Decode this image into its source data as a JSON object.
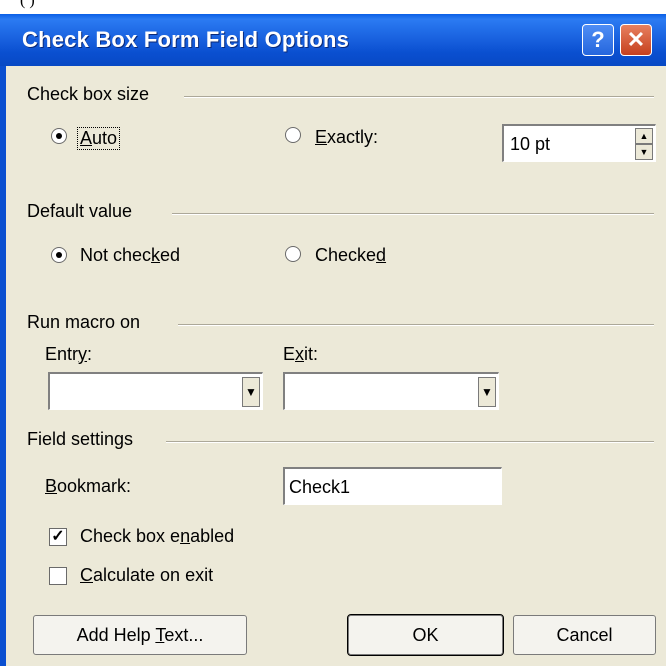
{
  "window": {
    "title": "Check Box Form Field Options",
    "top_fragment": "(         )",
    "help_glyph": "?",
    "close_glyph": "✕"
  },
  "size_group": {
    "heading": "Check box size",
    "auto_label": "Auto",
    "auto_selected": true,
    "exactly_label": "Exactly:",
    "exactly_value": "10 pt"
  },
  "default_group": {
    "heading": "Default value",
    "not_checked_label": "Not checked",
    "checked_label": "Checked",
    "selected": "Not checked"
  },
  "macro_group": {
    "heading": "Run macro on",
    "entry_label": "Entry:",
    "entry_value": "",
    "exit_label": "Exit:",
    "exit_value": ""
  },
  "field_settings": {
    "heading": "Field settings",
    "bookmark_label": "Bookmark:",
    "bookmark_value": "Check1",
    "enabled_label": "Check box enabled",
    "enabled_checked": true,
    "calculate_label": "Calculate on exit",
    "calculate_checked": false
  },
  "buttons": {
    "help_text": "Add Help Text...",
    "ok": "OK",
    "cancel": "Cancel"
  }
}
